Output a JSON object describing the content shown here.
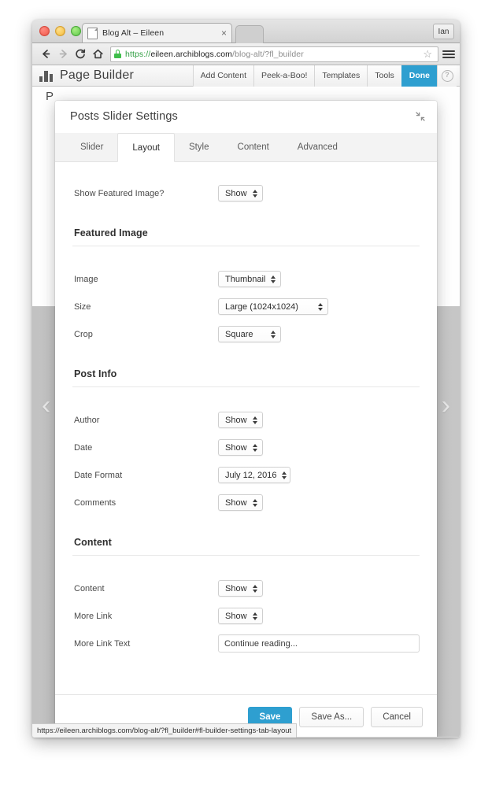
{
  "browser": {
    "tab": {
      "title": "Blog Alt – Eileen",
      "close_label": "×"
    },
    "profile_label": "Ian",
    "nav": {
      "back": "back-arrow",
      "forward": "forward-arrow",
      "reload": "C",
      "home": "home-icon"
    },
    "url": {
      "scheme": "https://",
      "host": "eileen.archiblogs.com",
      "path": "/blog-alt/?fl_builder"
    },
    "bookmark_icon": "☆",
    "menu_icon": "hamburger-icon",
    "status_url": "https://eileen.archiblogs.com/blog-alt/?fl_builder#fl-builder-settings-tab-layout"
  },
  "page_builder_bar": {
    "title": "Page Builder",
    "buttons": [
      {
        "label": "Add Content",
        "primary": false
      },
      {
        "label": "Peek-a-Boo!",
        "primary": false
      },
      {
        "label": "Templates",
        "primary": false
      },
      {
        "label": "Tools",
        "primary": false
      },
      {
        "label": "Done",
        "primary": true
      }
    ],
    "help_label": "?"
  },
  "page_behind": {
    "heading": "P",
    "arrow_left": "‹",
    "arrow_right": "›"
  },
  "modal": {
    "title": "Posts Slider Settings",
    "collapse_icon": "collapse-diagonal-icon",
    "tabs": [
      {
        "label": "Slider",
        "active": false
      },
      {
        "label": "Layout",
        "active": true
      },
      {
        "label": "Style",
        "active": false
      },
      {
        "label": "Content",
        "active": false
      },
      {
        "label": "Advanced",
        "active": false
      }
    ],
    "top_field": {
      "label": "Show Featured Image?",
      "value": "Show"
    },
    "sections": [
      {
        "title": "Featured Image",
        "fields": [
          {
            "label": "Image",
            "type": "select",
            "value": "Thumbnail",
            "width": "w-med"
          },
          {
            "label": "Size",
            "type": "select",
            "value": "Large (1024x1024)",
            "width": "w-wide"
          },
          {
            "label": "Crop",
            "type": "select",
            "value": "Square",
            "width": "w-med"
          }
        ]
      },
      {
        "title": "Post Info",
        "fields": [
          {
            "label": "Author",
            "type": "select",
            "value": "Show",
            "width": ""
          },
          {
            "label": "Date",
            "type": "select",
            "value": "Show",
            "width": ""
          },
          {
            "label": "Date Format",
            "type": "select",
            "value": "July 12, 2016",
            "width": "w-date"
          },
          {
            "label": "Comments",
            "type": "select",
            "value": "Show",
            "width": ""
          }
        ]
      },
      {
        "title": "Content",
        "fields": [
          {
            "label": "Content",
            "type": "select",
            "value": "Show",
            "width": ""
          },
          {
            "label": "More Link",
            "type": "select",
            "value": "Show",
            "width": ""
          },
          {
            "label": "More Link Text",
            "type": "text",
            "value": "Continue reading...",
            "width": ""
          }
        ]
      }
    ],
    "footer": {
      "save": "Save",
      "save_as": "Save As...",
      "cancel": "Cancel"
    }
  },
  "colors": {
    "accent": "#2e9fd0",
    "secure_green": "#3fbe4b",
    "modal_bg": "#ffffff",
    "tabs_bg": "#f3f3f3"
  }
}
